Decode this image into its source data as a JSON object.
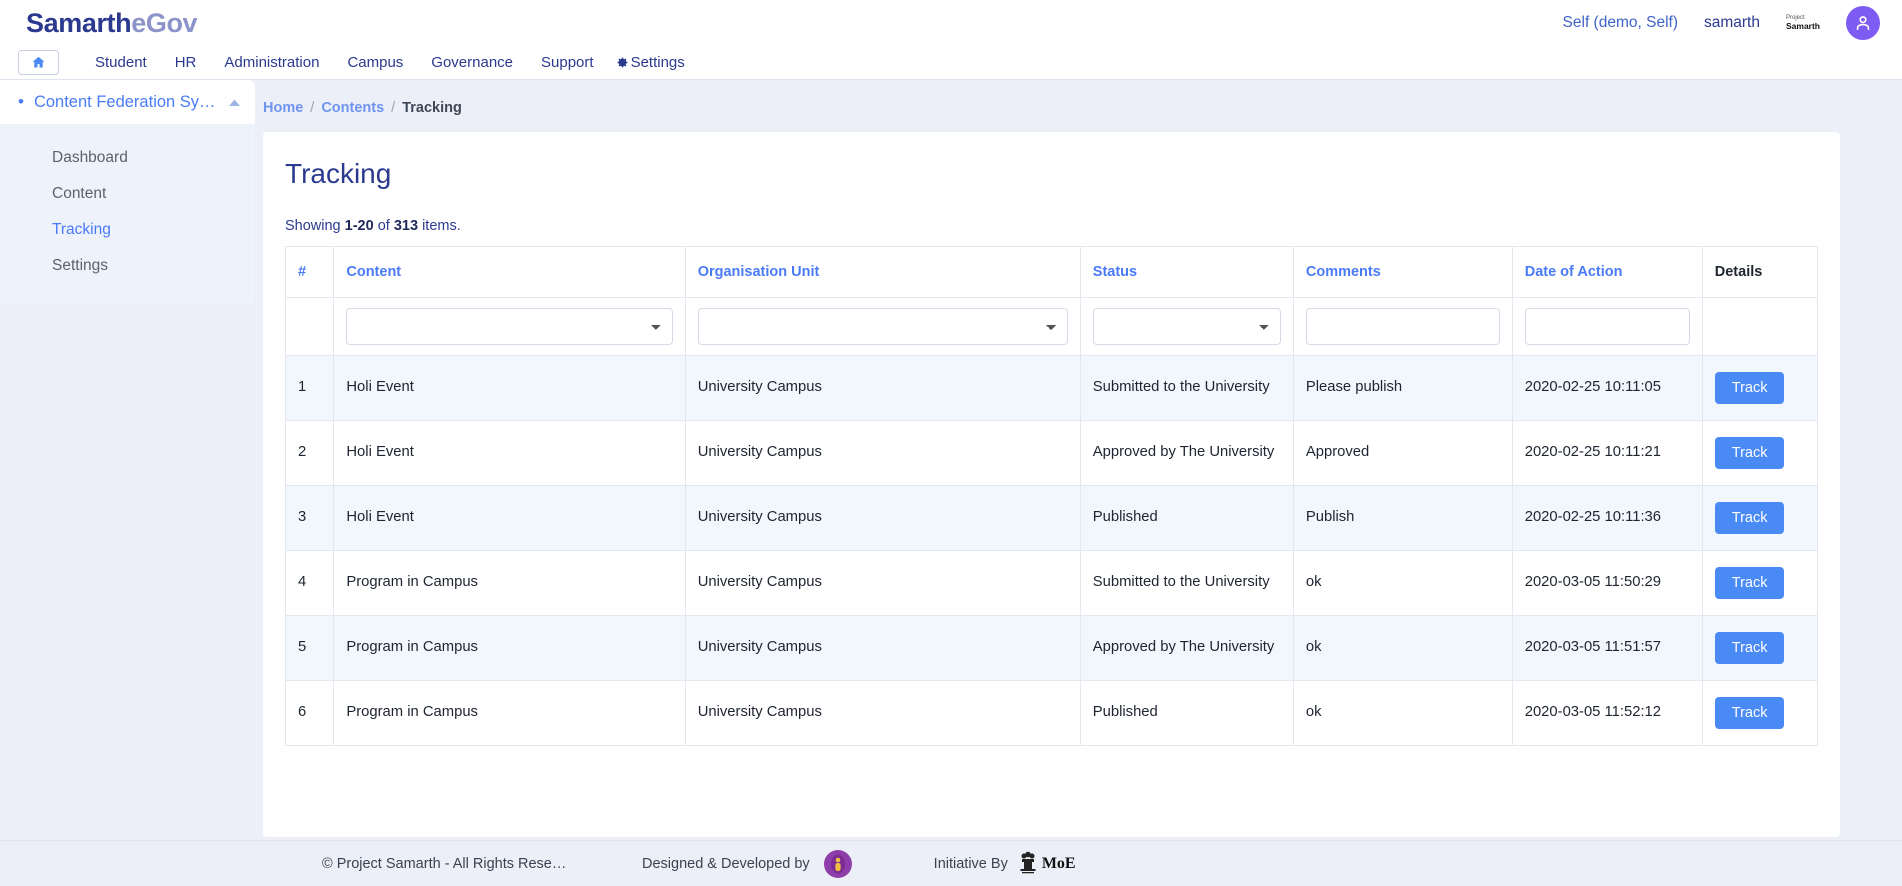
{
  "header": {
    "brand_primary": "Samarth",
    "brand_secondary": "eGov",
    "context_link": "Self (demo, Self)",
    "username": "samarth",
    "logo_line1": "Project",
    "logo_line2": "Samarth",
    "avatar_icon": "user-avatar-icon",
    "accent_color": "#7c5cf2"
  },
  "nav": {
    "home_icon": "home-icon",
    "items": [
      {
        "label": "Student"
      },
      {
        "label": "HR"
      },
      {
        "label": "Administration"
      },
      {
        "label": "Campus"
      },
      {
        "label": "Governance"
      },
      {
        "label": "Support"
      },
      {
        "label": "Settings",
        "icon": "gear-icon"
      }
    ]
  },
  "sidebar": {
    "module_title": "Content Federation Sy…",
    "bullet_icon": "bullet-dot-icon",
    "collapse_icon": "chevron-up-icon",
    "items": [
      {
        "label": "Dashboard",
        "active": false
      },
      {
        "label": "Content",
        "active": false
      },
      {
        "label": "Tracking",
        "active": true
      },
      {
        "label": "Settings",
        "active": false
      }
    ]
  },
  "breadcrumb": {
    "home": "Home",
    "contents": "Contents",
    "current": "Tracking",
    "separator": "/"
  },
  "main": {
    "page_title": "Tracking",
    "showing_prefix": "Showing ",
    "showing_range": "1-20",
    "showing_of": " of ",
    "showing_total": "313",
    "showing_suffix": " items."
  },
  "table": {
    "headers": {
      "num": "#",
      "content": "Content",
      "org_unit": "Organisation Unit",
      "status": "Status",
      "comments": "Comments",
      "date": "Date of Action",
      "details": "Details"
    },
    "filters": {
      "content_value": "",
      "org_unit_value": "",
      "status_value": "",
      "comments_value": "",
      "date_value": ""
    },
    "action_label": "Track",
    "action_color": "#4a8af4",
    "rows": [
      {
        "num": "1",
        "content": "Holi Event",
        "org_unit": "University Campus",
        "status": "Submitted to the University",
        "comments": "Please publish",
        "date": "2020-02-25 10:11:05"
      },
      {
        "num": "2",
        "content": "Holi Event",
        "org_unit": "University Campus",
        "status": "Approved by The University",
        "comments": "Approved",
        "date": "2020-02-25 10:11:21"
      },
      {
        "num": "3",
        "content": "Holi Event",
        "org_unit": "University Campus",
        "status": "Published",
        "comments": "Publish",
        "date": "2020-02-25 10:11:36"
      },
      {
        "num": "4",
        "content": "Program in Campus",
        "org_unit": "University Campus",
        "status": "Submitted to the University",
        "comments": "ok",
        "date": "2020-03-05 11:50:29"
      },
      {
        "num": "5",
        "content": "Program in Campus",
        "org_unit": "University Campus",
        "status": "Approved by The University",
        "comments": "ok",
        "date": "2020-03-05 11:51:57"
      },
      {
        "num": "6",
        "content": "Program in Campus",
        "org_unit": "University Campus",
        "status": "Published",
        "comments": "ok",
        "date": "2020-03-05 11:52:12"
      }
    ]
  },
  "footer": {
    "copyright": "© Project Samarth - All Rights Rese…",
    "designed_label": "Designed & Developed by",
    "designer_logo_icon": "iuac-logo-icon",
    "initiative_label": "Initiative By",
    "moe_emblem_icon": "india-emblem-icon",
    "moe_text": "MoE"
  }
}
